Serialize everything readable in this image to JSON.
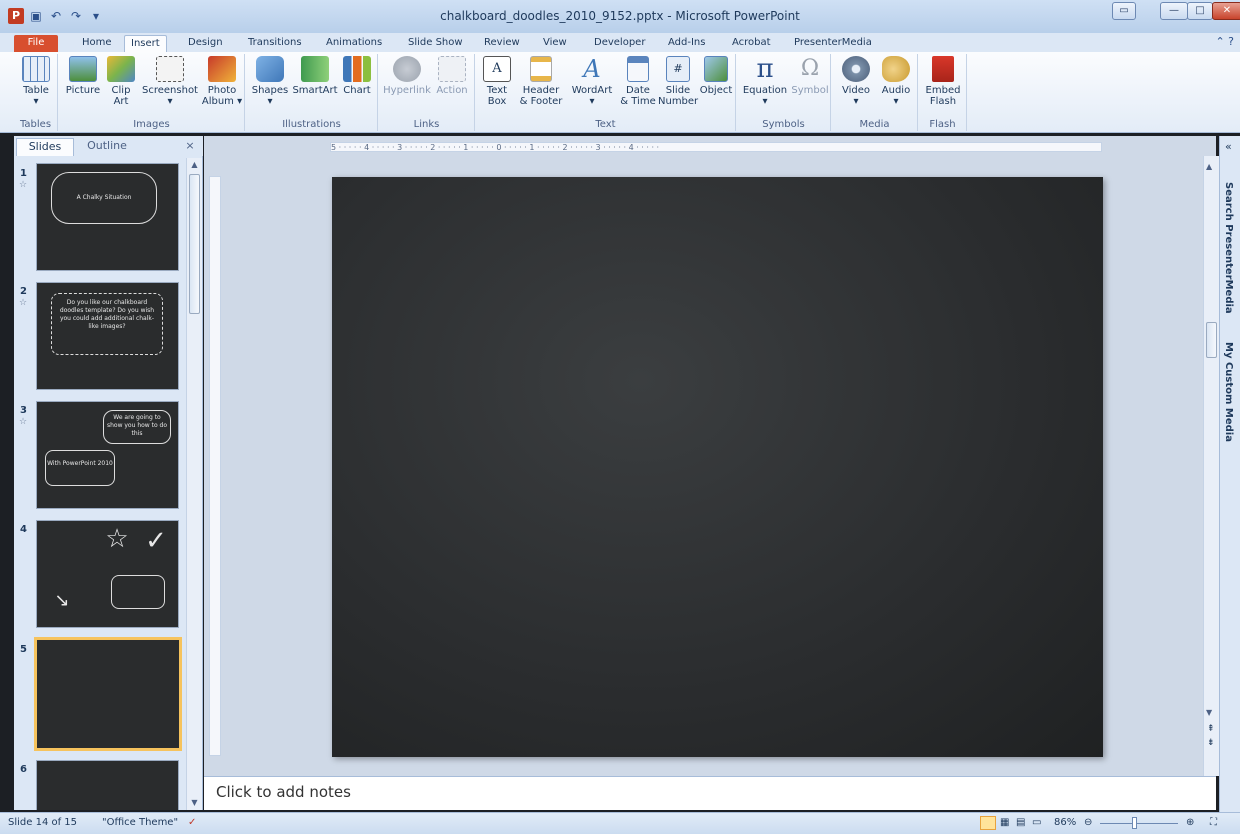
{
  "window": {
    "title": "chalkboard_doodles_2010_9152.pptx - Microsoft PowerPoint",
    "app_badge": "P"
  },
  "tabs": [
    "File",
    "Home",
    "Insert",
    "Design",
    "Transitions",
    "Animations",
    "Slide Show",
    "Review",
    "View",
    "Developer",
    "Add-Ins",
    "Acrobat",
    "PresenterMedia"
  ],
  "active_tab": "Insert",
  "ribbon": {
    "groups": [
      {
        "label": "Tables",
        "buttons": [
          {
            "label": "Table",
            "sub": "▾"
          }
        ]
      },
      {
        "label": "Images",
        "buttons": [
          {
            "label": "Picture",
            "sub": ""
          },
          {
            "label": "Clip",
            "sub": "Art"
          },
          {
            "label": "Screenshot",
            "sub": "▾"
          },
          {
            "label": "Photo",
            "sub": "Album ▾"
          }
        ]
      },
      {
        "label": "Illustrations",
        "buttons": [
          {
            "label": "Shapes",
            "sub": "▾"
          },
          {
            "label": "SmartArt",
            "sub": ""
          },
          {
            "label": "Chart",
            "sub": ""
          }
        ]
      },
      {
        "label": "Links",
        "buttons": [
          {
            "label": "Hyperlink",
            "sub": ""
          },
          {
            "label": "Action",
            "sub": ""
          }
        ]
      },
      {
        "label": "Text",
        "buttons": [
          {
            "label": "Text",
            "sub": "Box"
          },
          {
            "label": "Header",
            "sub": "& Footer"
          },
          {
            "label": "WordArt",
            "sub": "▾"
          },
          {
            "label": "Date",
            "sub": "& Time"
          },
          {
            "label": "Slide",
            "sub": "Number"
          },
          {
            "label": "Object",
            "sub": ""
          }
        ]
      },
      {
        "label": "Symbols",
        "buttons": [
          {
            "label": "Equation",
            "sub": "▾"
          },
          {
            "label": "Symbol",
            "sub": ""
          }
        ]
      },
      {
        "label": "Media",
        "buttons": [
          {
            "label": "Video",
            "sub": "▾"
          },
          {
            "label": "Audio",
            "sub": "▾"
          }
        ]
      },
      {
        "label": "Flash",
        "buttons": [
          {
            "label": "Embed",
            "sub": "Flash"
          }
        ]
      }
    ]
  },
  "left_panel": {
    "tab_slides": "Slides",
    "tab_outline": "Outline",
    "close": "×",
    "thumbnails": [
      {
        "num": "1",
        "text": "A Chalky Situation"
      },
      {
        "num": "2",
        "text": "Do you like our chalkboard doodles template? Do you wish you could add additional chalk-like images?"
      },
      {
        "num": "3",
        "text": "We are going to show you how to do this",
        "text2": "With PowerPoint 2010"
      },
      {
        "num": "4",
        "text": ""
      },
      {
        "num": "5",
        "text": ""
      },
      {
        "num": "6",
        "text": ""
      }
    ],
    "star": "☆"
  },
  "ruler": {
    "h_labels": "5 · · · · · 4 · · · · · 3 · · · · · 2 · · · · · 1 · · · · · 0 · · · · · 1 · · · · · 2 · · · · · 3 · · · · · 4 · · · · ·"
  },
  "notes": {
    "placeholder": "Click to add notes"
  },
  "right_pane": {
    "item1": "Search PresenterMedia",
    "item2": "My Custom Media",
    "collapse": "«"
  },
  "status": {
    "slide": "Slide 14 of 15",
    "theme": "\"Office Theme\"",
    "zoom": "86%"
  }
}
